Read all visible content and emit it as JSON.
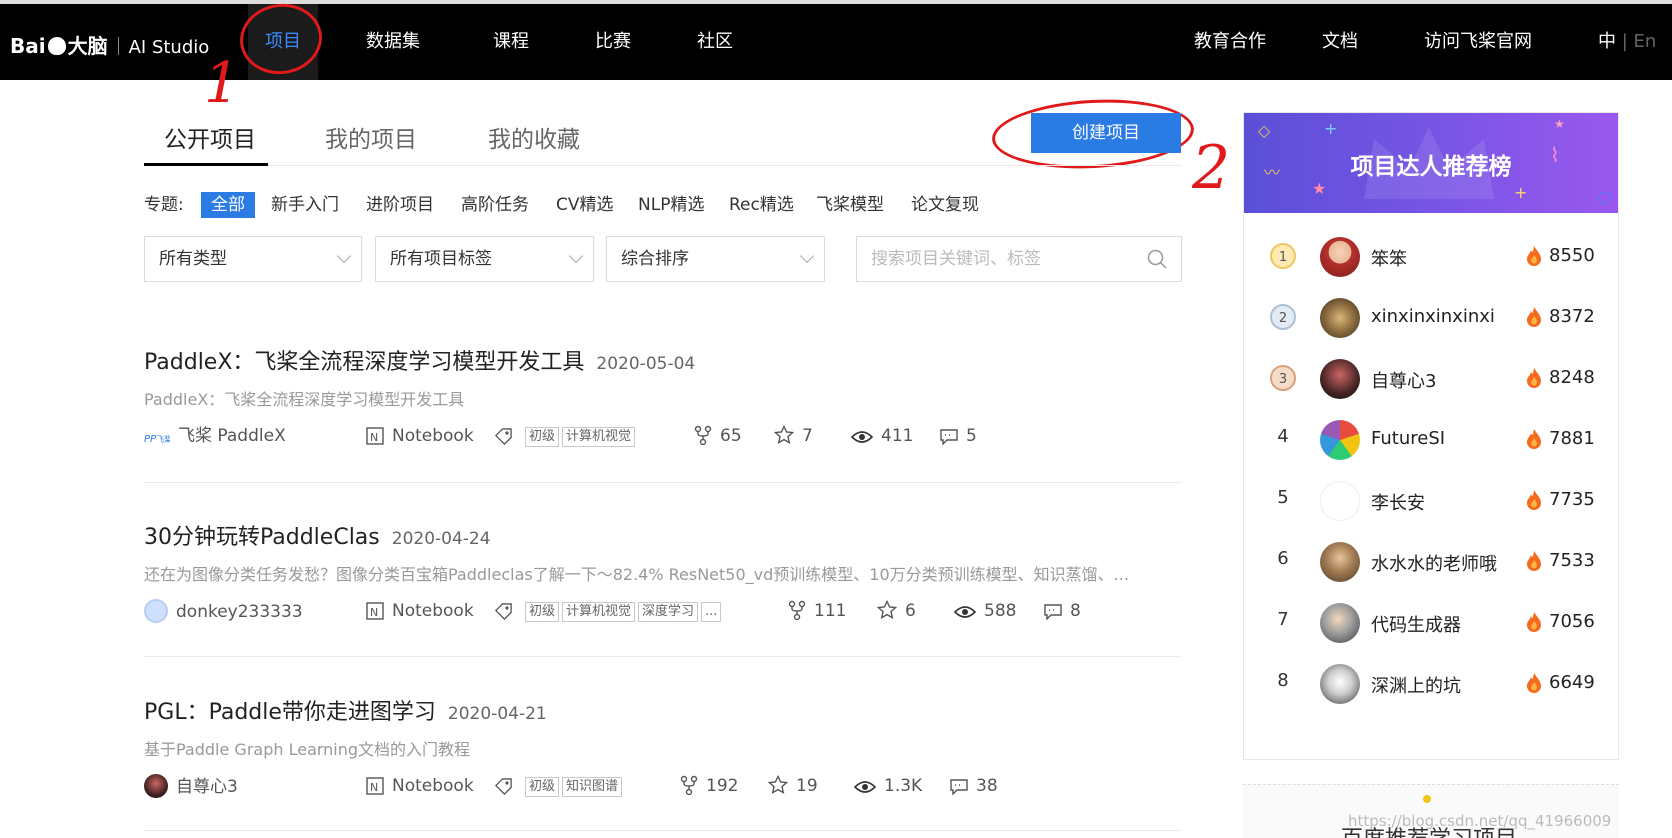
{
  "header": {
    "logo_text": "Bai",
    "logo_text2": "大脑",
    "logo_product": "AI Studio",
    "nav": [
      {
        "label": "项目"
      },
      {
        "label": "数据集"
      },
      {
        "label": "课程"
      },
      {
        "label": "比赛"
      },
      {
        "label": "社区"
      }
    ],
    "right_nav": [
      {
        "label": "教育合作"
      },
      {
        "label": "文档"
      },
      {
        "label": "访问飞桨官网"
      }
    ],
    "lang_zh": "中",
    "lang_sep": "|",
    "lang_en": "En"
  },
  "annotations": {
    "one": "1",
    "two": "2"
  },
  "tabs": [
    {
      "label": "公开项目",
      "active": true
    },
    {
      "label": "我的项目"
    },
    {
      "label": "我的收藏"
    }
  ],
  "create_button": "创建项目",
  "topics": {
    "label": "专题:",
    "items": [
      "全部",
      "新手入门",
      "进阶项目",
      "高阶任务",
      "CV精选",
      "NLP精选",
      "Rec精选",
      "飞桨模型",
      "论文复现"
    ]
  },
  "filters": {
    "type": "所有类型",
    "tags": "所有项目标签",
    "sort": "综合排序",
    "search_placeholder": "搜索项目关键词、标签"
  },
  "projects": [
    {
      "title": "PaddleX：飞桨全流程深度学习模型开发工具",
      "date": "2020-05-04",
      "desc": "PaddleX：飞桨全流程深度学习模型开发工具",
      "author": "飞桨 PaddleX",
      "type": "Notebook",
      "tags": [
        "初级",
        "计算机视觉"
      ],
      "forks": "65",
      "stars": "7",
      "views": "411",
      "comments": "5"
    },
    {
      "title": "30分钟玩转PaddleClas",
      "date": "2020-04-24",
      "desc": "还在为图像分类任务发愁？图像分类百宝箱Paddleclas了解一下～82.4% ResNet50_vd预训练模型、10万分类预训练模型、知识蒸馏、...",
      "author": "donkey233333",
      "type": "Notebook",
      "tags": [
        "初级",
        "计算机视觉",
        "深度学习",
        "..."
      ],
      "forks": "111",
      "stars": "6",
      "views": "588",
      "comments": "8"
    },
    {
      "title": "PGL：Paddle带你走进图学习",
      "date": "2020-04-21",
      "desc": "基于Paddle Graph Learning文档的入门教程",
      "author": "自尊心3",
      "type": "Notebook",
      "tags": [
        "初级",
        "知识图谱"
      ],
      "forks": "192",
      "stars": "19",
      "views": "1.3K",
      "comments": "38"
    }
  ],
  "leaderboard": {
    "title": "项目达人推荐榜",
    "rows": [
      {
        "rank": "1",
        "name": "笨笨",
        "score": "8550"
      },
      {
        "rank": "2",
        "name": "xinxinxinxinxi",
        "score": "8372"
      },
      {
        "rank": "3",
        "name": "自尊心3",
        "score": "8248"
      },
      {
        "rank": "4",
        "name": "FutureSI",
        "score": "7881"
      },
      {
        "rank": "5",
        "name": "李长安",
        "score": "7735"
      },
      {
        "rank": "6",
        "name": "水水水的老师哦",
        "score": "7533"
      },
      {
        "rank": "7",
        "name": "代码生成器",
        "score": "7056"
      },
      {
        "rank": "8",
        "name": "深渊上的坑",
        "score": "6649"
      }
    ]
  },
  "learn_card_title": "百度推荐学习项目",
  "watermark": "https://blog.csdn.net/qq_41966009",
  "colors": {
    "accent": "#2b7be5",
    "annotation": "#e0191b",
    "topbar": "#000000"
  }
}
